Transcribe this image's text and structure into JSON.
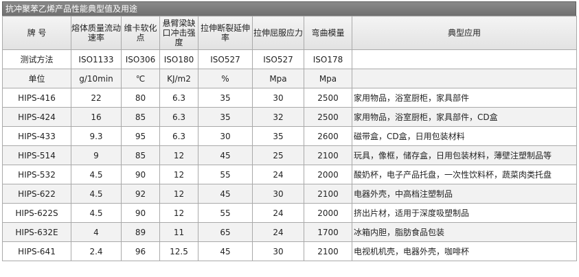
{
  "title": "抗冲聚苯乙烯产品性能典型值及用途",
  "columns": [
    "牌 号",
    "熔体质量流动速率",
    "维卡软化点",
    "悬臂梁缺口冲击强度",
    "拉伸断裂延伸率",
    "拉伸屈服应力",
    "弯曲模量",
    "典型应用"
  ],
  "rows": [
    {
      "grade": "测试方法",
      "mfr": "ISO1133",
      "vicat": "ISO306",
      "impact": "ISO180",
      "elong": "ISO527",
      "yield": "ISO527",
      "modulus": "ISO178",
      "app": ""
    },
    {
      "grade": "单位",
      "mfr": "g/10min",
      "vicat": "℃",
      "impact": "KJ/m2",
      "elong": "%",
      "yield": "Mpa",
      "modulus": "Mpa",
      "app": ""
    },
    {
      "grade": "HIPS-416",
      "mfr": "22",
      "vicat": "80",
      "impact": "6.3",
      "elong": "35",
      "yield": "30",
      "modulus": "2500",
      "app": "家用物品，浴室厨柜，家具部件"
    },
    {
      "grade": "HIPS-424",
      "mfr": "16",
      "vicat": "85",
      "impact": "6.3",
      "elong": "35",
      "yield": "32",
      "modulus": "2500",
      "app": "家用物品，浴室厨柜，家具部件，CD盒"
    },
    {
      "grade": "HIPS-433",
      "mfr": "9.3",
      "vicat": "95",
      "impact": "6.3",
      "elong": "30",
      "yield": "35",
      "modulus": "2600",
      "app": "磁带盒，CD盒，日用包装材料"
    },
    {
      "grade": "HIPS-514",
      "mfr": "9",
      "vicat": "85",
      "impact": "12",
      "elong": "45",
      "yield": "25",
      "modulus": "2100",
      "app": "玩具，像框，储存盒，日用包装材料，薄壁注塑制品等"
    },
    {
      "grade": "HIPS-532",
      "mfr": "4.5",
      "vicat": "90",
      "impact": "12",
      "elong": "55",
      "yield": "24",
      "modulus": "2000",
      "app": "酸奶杯，电子产品托盘，一次性饮料杯，蔬菜肉类托盘"
    },
    {
      "grade": "HIPS-622",
      "mfr": "4.5",
      "vicat": "92",
      "impact": "12",
      "elong": "45",
      "yield": "30",
      "modulus": "2100",
      "app": "电器外壳，中高档注塑制品"
    },
    {
      "grade": "HIPS-622S",
      "mfr": "4.5",
      "vicat": "90",
      "impact": "12",
      "elong": "55",
      "yield": "24",
      "modulus": "2000",
      "app": "挤出片材，适用于深度吸塑制品"
    },
    {
      "grade": "HIPS-632E",
      "mfr": "4",
      "vicat": "89",
      "impact": "11",
      "elong": "65",
      "yield": "24",
      "modulus": "1700",
      "app": "冰箱内胆，脂肪食品包装"
    },
    {
      "grade": "HIPS-641",
      "mfr": "2.4",
      "vicat": "96",
      "impact": "12.5",
      "elong": "45",
      "yield": "30",
      "modulus": "2100",
      "app": "电视机机壳，电器外壳，咖啡杯"
    }
  ]
}
